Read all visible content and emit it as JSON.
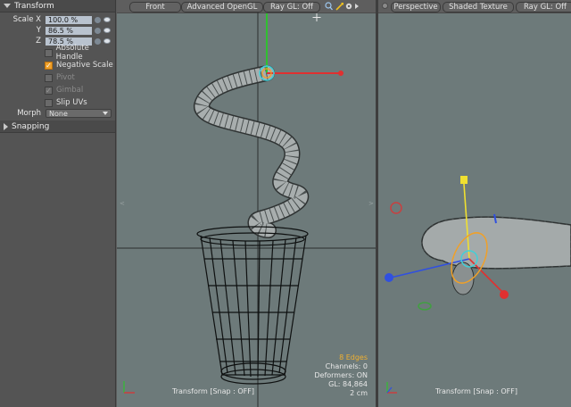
{
  "panel": {
    "transform_title": "Transform",
    "scale": [
      {
        "axis": "Scale X",
        "value": "100.0 %"
      },
      {
        "axis": "Y",
        "value": "86.5 %"
      },
      {
        "axis": "Z",
        "value": "78.5 %"
      }
    ],
    "options": [
      {
        "label": "Absolute Handle",
        "checked": false,
        "enabled": true
      },
      {
        "label": "Negative Scale",
        "checked": true,
        "enabled": true
      },
      {
        "label": "Pivot",
        "checked": false,
        "enabled": false
      },
      {
        "label": "Gimbal",
        "checked": true,
        "enabled": false
      },
      {
        "label": "Slip UVs",
        "checked": false,
        "enabled": true
      }
    ],
    "morph_label": "Morph",
    "morph_value": "None",
    "snapping_title": "Snapping"
  },
  "viewport_front": {
    "view_label": "Front",
    "shading_label": "Advanced OpenGL",
    "ray_label": "Ray GL: Off",
    "hud": {
      "edges": "8 Edges",
      "channels": "Channels: 0",
      "deformers": "Deformers: ON",
      "gl": "GL: 84,864",
      "scale": "2 cm"
    },
    "status": "Transform  [Snap : OFF]"
  },
  "viewport_persp": {
    "view_label": "Perspective",
    "shading_label": "Shaded Texture",
    "ray_label": "Ray GL: Off",
    "status": "Transform  [Snap : OFF]"
  },
  "colors": {
    "accent": "#f0a028",
    "edges_text": "#f0b030",
    "viewport_bg": "#6d7a7a",
    "x_axis": "#e03030",
    "y_axis": "#30c030",
    "z_axis": "#3050e0"
  }
}
